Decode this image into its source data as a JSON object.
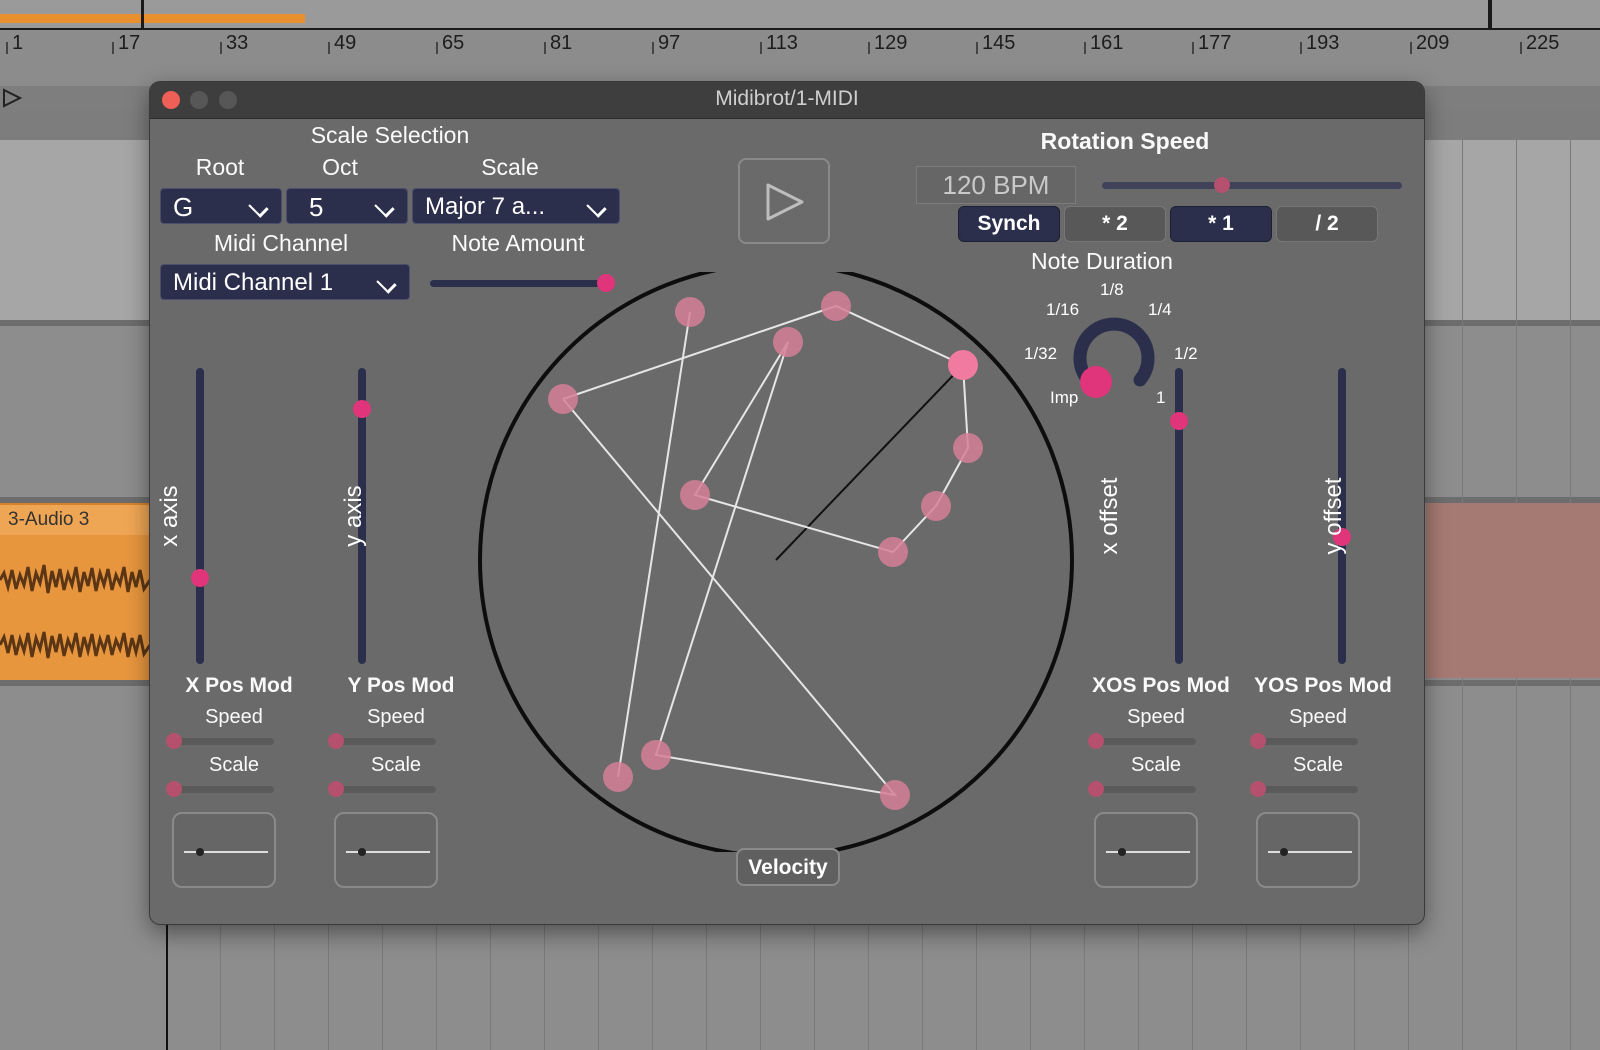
{
  "daw": {
    "ruler_ticks": [
      "1",
      "17",
      "33",
      "49",
      "65",
      "81",
      "97",
      "113",
      "129",
      "145",
      "161",
      "177",
      "193",
      "209",
      "225"
    ],
    "audio_clip_label": "3-Audio 3"
  },
  "window": {
    "title": "Midibrot/1-MIDI"
  },
  "scale_selection": {
    "title": "Scale Selection",
    "root_label": "Root",
    "root_value": "G",
    "oct_label": "Oct",
    "oct_value": "5",
    "scale_label": "Scale",
    "scale_value": "Major 7 a...",
    "midi_channel_label": "Midi Channel",
    "midi_channel_value": "Midi Channel 1",
    "note_amount_label": "Note Amount",
    "note_amount_value_fraction": 0.98
  },
  "rotation": {
    "title": "Rotation Speed",
    "bpm": "120 BPM",
    "slider_fraction": 0.4,
    "buttons": [
      "Synch",
      "* 2",
      "* 1",
      "/ 2"
    ]
  },
  "note_duration": {
    "title": "Note Duration",
    "labels": [
      "1/8",
      "1/16",
      "1/4",
      "1/32",
      "1/2",
      "Imp",
      "1"
    ]
  },
  "modulators": [
    {
      "axis_label": "x axis",
      "title": "X Pos Mod",
      "speed_label": "Speed",
      "scale_label": "Scale",
      "level_fraction": 0.29
    },
    {
      "axis_label": "y axis",
      "title": "Y Pos Mod",
      "speed_label": "Speed",
      "scale_label": "Scale",
      "level_fraction": 0.86
    },
    {
      "axis_label": "x offset",
      "title": "XOS Pos Mod",
      "speed_label": "Speed",
      "scale_label": "Scale",
      "level_fraction": 0.82
    },
    {
      "axis_label": "y offset",
      "title": "YOS Pos Mod",
      "speed_label": "Speed",
      "scale_label": "Scale",
      "level_fraction": 0.43
    }
  ],
  "velocity_label": "Velocity",
  "colors": {
    "accent": "#e0357a",
    "control_dark": "#2b2f4c",
    "panel": "#6a6a6a",
    "clip_orange": "#e8963e"
  }
}
